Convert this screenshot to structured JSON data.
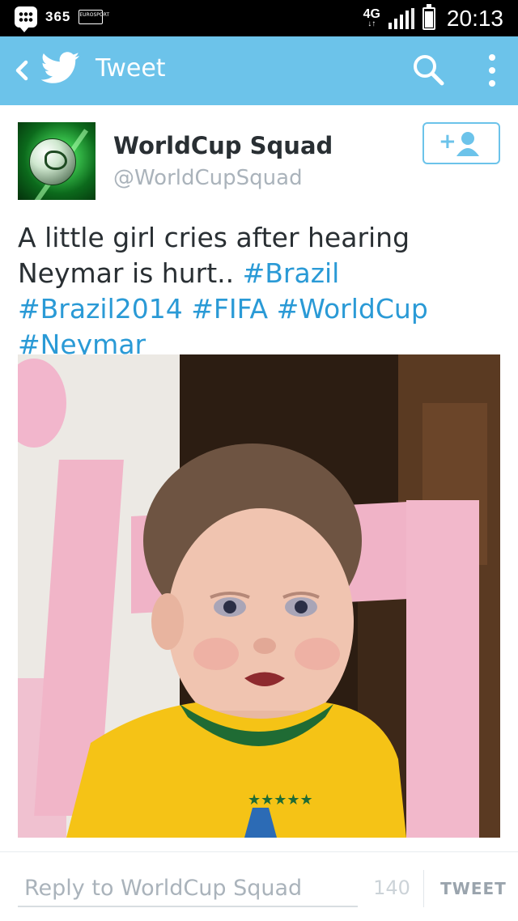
{
  "status_bar": {
    "app_365_label": "365",
    "eurosport_label": "EUROSPORT",
    "network_type": "4G",
    "clock": "20:13"
  },
  "app_bar": {
    "title": "Tweet",
    "background_color": "#6cc3ea"
  },
  "tweet": {
    "display_name": "WorldCup Squad",
    "handle": "@WorldCupSquad",
    "text_plain": "A little girl cries after hearing Neymar is hurt.. ",
    "hashtags": [
      "#Brazil",
      "#Brazil2014",
      "#FIFA",
      "#WorldCup",
      "#Neymar"
    ],
    "hashtag_color": "#2a9ad6",
    "follow_label": "+"
  },
  "reply_bar": {
    "placeholder": "Reply to WorldCup Squad",
    "char_count": "140",
    "tweet_button_label": "TWEET"
  },
  "icons": [
    "back-icon",
    "twitter-bird-icon",
    "search-icon",
    "overflow-menu-icon",
    "follow-user-icon",
    "bbm-icon",
    "signal-icon",
    "battery-icon"
  ]
}
